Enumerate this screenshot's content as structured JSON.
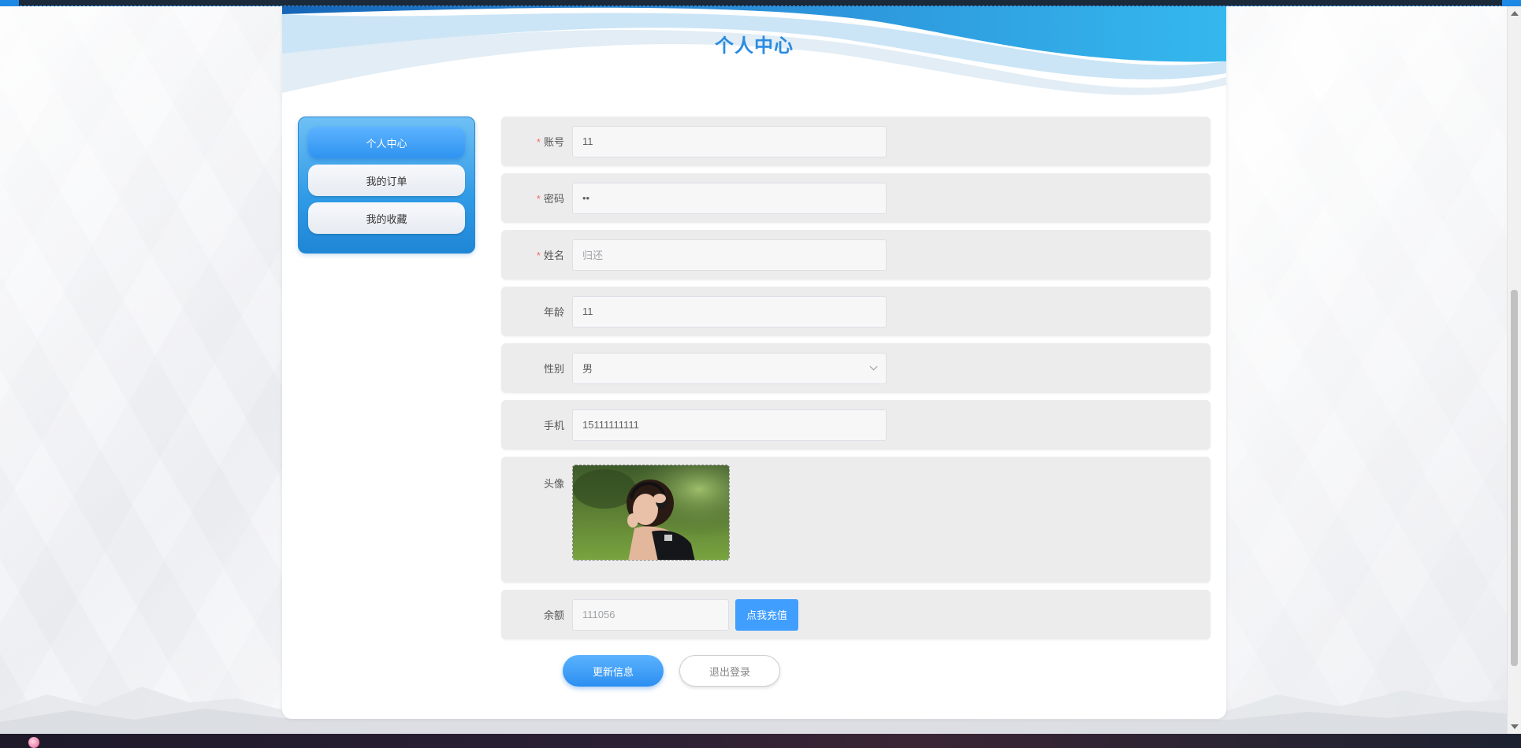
{
  "page": {
    "title": "个人中心"
  },
  "sidebar": {
    "items": [
      {
        "label": "个人中心",
        "active": true
      },
      {
        "label": "我的订单",
        "active": false
      },
      {
        "label": "我的收藏",
        "active": false
      }
    ]
  },
  "form": {
    "account": {
      "label": "账号",
      "required": true,
      "value": "11"
    },
    "password": {
      "label": "密码",
      "required": true,
      "value": "••"
    },
    "name": {
      "label": "姓名",
      "required": true,
      "value": "归还"
    },
    "age": {
      "label": "年龄",
      "required": false,
      "value": "11"
    },
    "gender": {
      "label": "性别",
      "required": false,
      "value": "男"
    },
    "phone": {
      "label": "手机",
      "required": false,
      "value": "15111111111"
    },
    "avatar": {
      "label": "头像",
      "icon": "avatar-photo"
    },
    "balance": {
      "label": "余额",
      "value": "111056",
      "recharge_label": "点我充值"
    }
  },
  "actions": {
    "update_label": "更新信息",
    "logout_label": "退出登录"
  },
  "colors": {
    "accent": "#409eff",
    "title": "#2a8be0",
    "required": "#f56c6c"
  }
}
